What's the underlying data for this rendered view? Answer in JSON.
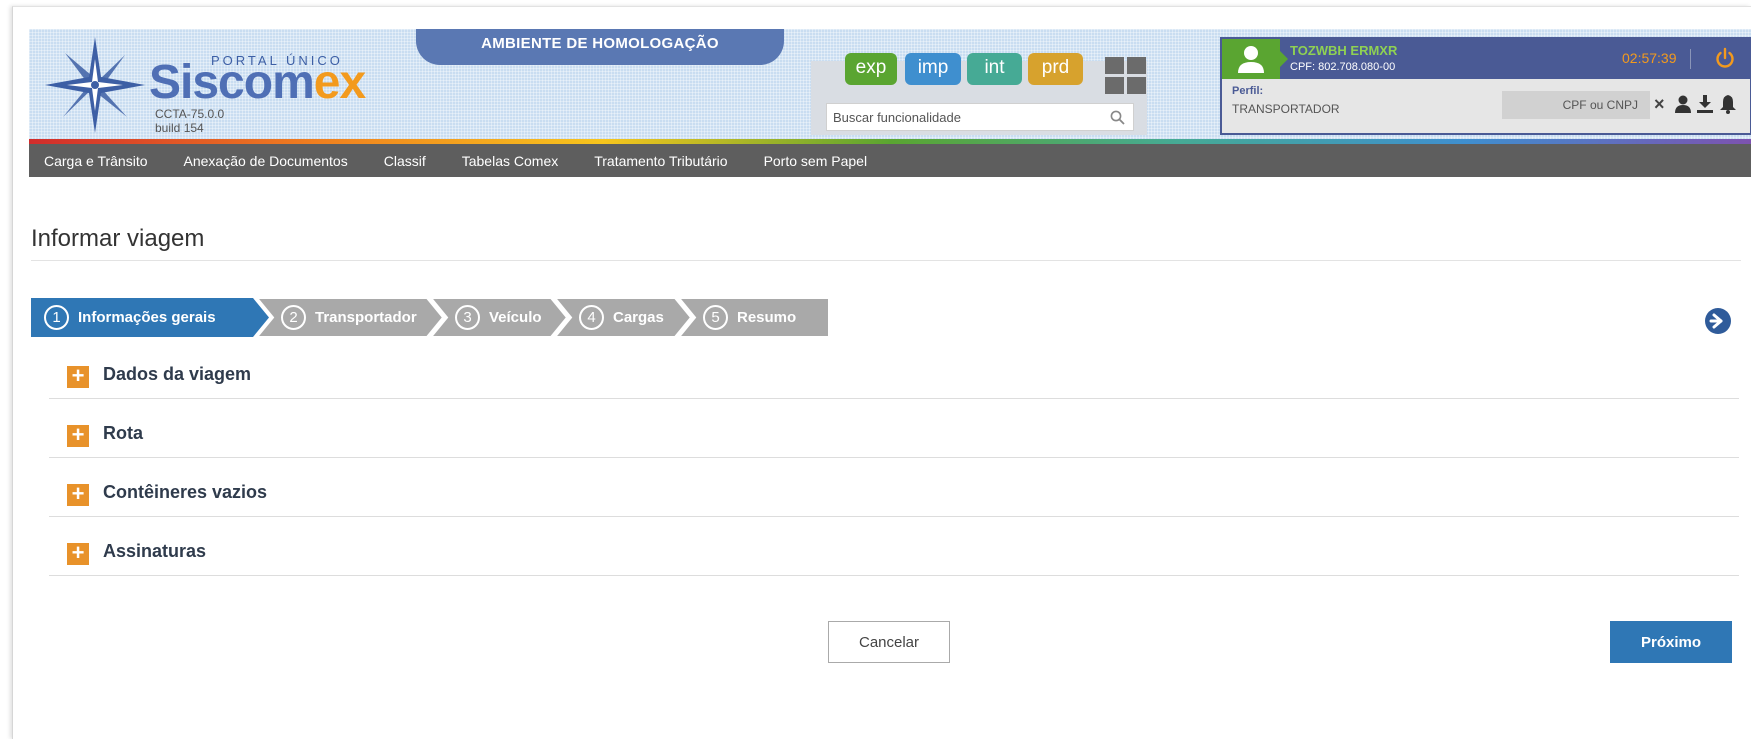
{
  "header": {
    "portal_label": "PORTAL ÚNICO",
    "brand_part1": "Siscom",
    "brand_part2": "ex",
    "version": "CCTA-75.0.0",
    "build": "build 154",
    "environment_banner": "AMBIENTE DE HOMOLOGAÇÃO",
    "systems": [
      {
        "label": "exp",
        "color": "#5aa531"
      },
      {
        "label": "imp",
        "color": "#3f8fcf"
      },
      {
        "label": "int",
        "color": "#46aa95"
      },
      {
        "label": "prd",
        "color": "#d7a22d"
      }
    ],
    "grid_icon": "apps-grid-icon",
    "search": {
      "placeholder": "Buscar funcionalidade",
      "value": ""
    },
    "user": {
      "name": "TOZWBH ERMXR",
      "cpf": "CPF: 802.708.080-00",
      "session_timer": "02:57:39",
      "perfil_label": "Perfil:",
      "perfil_value": "TRANSPORTADOR",
      "cpf_cnpj_placeholder": "CPF ou CNPJ",
      "clear_symbol": "×"
    }
  },
  "menu": {
    "items": [
      {
        "label": "Carga e Trânsito"
      },
      {
        "label": "Anexação de Documentos"
      },
      {
        "label": "Classif"
      },
      {
        "label": "Tabelas Comex"
      },
      {
        "label": "Tratamento Tributário"
      },
      {
        "label": "Porto sem Papel"
      }
    ]
  },
  "page": {
    "title": "Informar viagem"
  },
  "wizard": {
    "active_index": 0,
    "active_color": "#2f77b5",
    "inactive_color": "#a9a9a9",
    "steps": [
      {
        "number": "1",
        "label": "Informações gerais"
      },
      {
        "number": "2",
        "label": "Transportador"
      },
      {
        "number": "3",
        "label": "Veículo"
      },
      {
        "number": "4",
        "label": "Cargas"
      },
      {
        "number": "5",
        "label": "Resumo"
      }
    ]
  },
  "sections": [
    {
      "title": "Dados da viagem"
    },
    {
      "title": "Rota"
    },
    {
      "title": "Contêineres vazios"
    },
    {
      "title": "Assinaturas"
    }
  ],
  "accordion_toggle_symbol": "+",
  "actions": {
    "cancel_label": "Cancelar",
    "next_label": "Próximo"
  }
}
